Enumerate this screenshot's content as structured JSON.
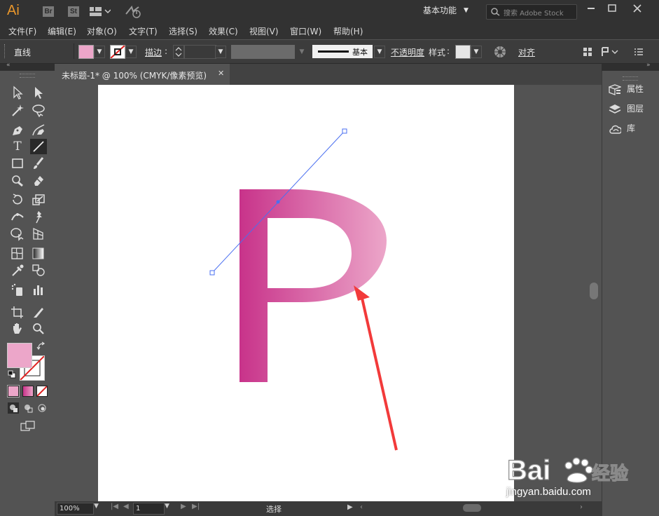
{
  "app": {
    "logo_text": "Ai",
    "bridge_label": "Br",
    "stock_label": "St",
    "workspace": "基本功能",
    "search_placeholder": "搜索 Adobe Stock"
  },
  "menu": [
    "文件(F)",
    "编辑(E)",
    "对象(O)",
    "文字(T)",
    "选择(S)",
    "效果(C)",
    "视图(V)",
    "窗口(W)",
    "帮助(H)"
  ],
  "control_bar": {
    "tool_label": "直线",
    "stroke_label": "描边",
    "stroke_weight": "",
    "profile_label": "基本",
    "opacity_label": "不透明度",
    "style_label": "样式",
    "align_label": "对齐"
  },
  "document": {
    "tab_title": "未标题-1* @ 100% (CMYK/像素预览)",
    "close_glyph": "✕"
  },
  "right_panel": {
    "items": [
      "属性",
      "图层",
      "库"
    ]
  },
  "status_bar": {
    "zoom": "100%",
    "page": "1",
    "tool_status": "选择"
  },
  "colors": {
    "fill": "#eca6c9",
    "gradient_start": "#c8338a",
    "gradient_end": "#eca6c9",
    "annotation_arrow": "#f23a3a",
    "path_line": "#4a6ff0"
  },
  "watermark": {
    "brand": "Bai 经验",
    "url": "jingyan.baidu.com"
  },
  "artwork": {
    "letter": "P"
  }
}
